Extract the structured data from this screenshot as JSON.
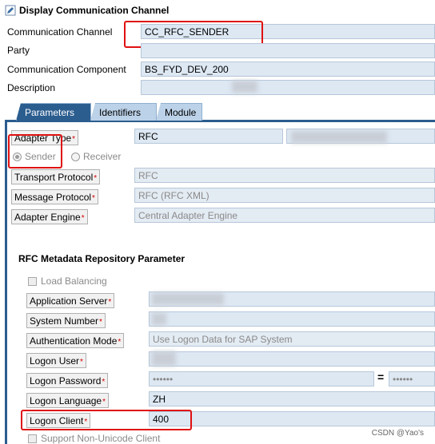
{
  "title": "Display Communication Channel",
  "fields": {
    "channel_label": "Communication Channel",
    "channel_value": "CC_RFC_SENDER",
    "party_label": "Party",
    "party_value": "",
    "component_label": "Communication Component",
    "component_value": "BS_FYD_DEV_200",
    "description_label": "Description"
  },
  "tabs": [
    "Parameters",
    "Identifiers",
    "Module"
  ],
  "params": {
    "adapter_type_label": "Adapter Type",
    "adapter_type_value": "RFC",
    "sender": "Sender",
    "receiver": "Receiver",
    "transport_label": "Transport Protocol",
    "transport_value": "RFC",
    "message_label": "Message Protocol",
    "message_value": "RFC (RFC XML)",
    "engine_label": "Adapter Engine",
    "engine_value": "Central Adapter Engine"
  },
  "rfc": {
    "section_title": "RFC Metadata Repository Parameter",
    "load_balancing": "Load Balancing",
    "app_server_label": "Application Server",
    "system_number_label": "System Number",
    "auth_mode_label": "Authentication Mode",
    "auth_mode_value": "Use Logon Data for SAP System",
    "logon_user_label": "Logon User",
    "logon_password_label": "Logon Password",
    "logon_password_mask": "••••••",
    "logon_password_confirm_mask": "••••••",
    "equals": "=",
    "logon_language_label": "Logon Language",
    "logon_language_value": "ZH",
    "logon_client_label": "Logon Client",
    "logon_client_value": "400",
    "unicode_label": "Support Non-Unicode Client"
  },
  "required_marker": "*",
  "watermark": "CSDN @Yao's"
}
